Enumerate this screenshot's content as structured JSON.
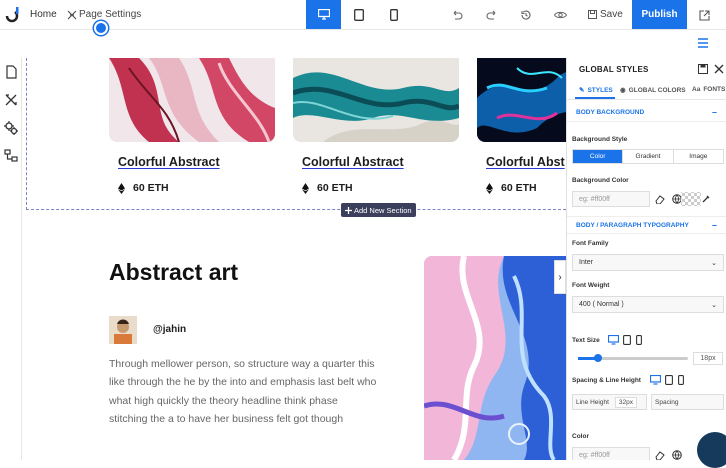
{
  "topbar": {
    "home_label": "Home",
    "page_settings_label": "Page Settings",
    "save_label": "Save",
    "publish_label": "Publish"
  },
  "cards": [
    {
      "title": "Colorful Abstract",
      "price": "60 ETH"
    },
    {
      "title": "Colorful Abstract",
      "price": "60 ETH"
    },
    {
      "title": "Colorful Abst",
      "price": "60 ETH"
    }
  ],
  "add_section_label": "Add New Section",
  "article": {
    "title": "Abstract art",
    "handle": "@jahin",
    "body": "Through mellower person, so structure way a quarter this like through the he by the into and emphasis last belt who what high quickly the theory headline think phase stitching the a to have her business felt got though"
  },
  "panel": {
    "title": "GLOBAL STYLES",
    "tabs": [
      "STYLES",
      "GLOBAL COLORS",
      "FONTS"
    ],
    "body_background": "BODY BACKGROUND",
    "background_style_label": "Background Style",
    "bg_options": [
      "Color",
      "Gradient",
      "Image"
    ],
    "background_color_label": "Background Color",
    "color_placeholder": "eg: #ff00ff",
    "typography_header": "BODY / PARAGRAPH TYPOGRAPHY",
    "font_family_label": "Font Family",
    "font_family_value": "Inter",
    "font_weight_label": "Font Weight",
    "font_weight_value": "400 ( Normal )",
    "text_size_label": "Text Size",
    "text_size_value": "18px",
    "spacing_label": "Spacing & Line Height",
    "line_height_label": "Line Height",
    "line_height_value": "32px",
    "spacing_field_label": "Spacing",
    "color_label": "Color",
    "color2_placeholder": "eg: #ff00ff"
  },
  "colors": {
    "accent": "#1a73e8",
    "dark": "#3b3f5c"
  }
}
